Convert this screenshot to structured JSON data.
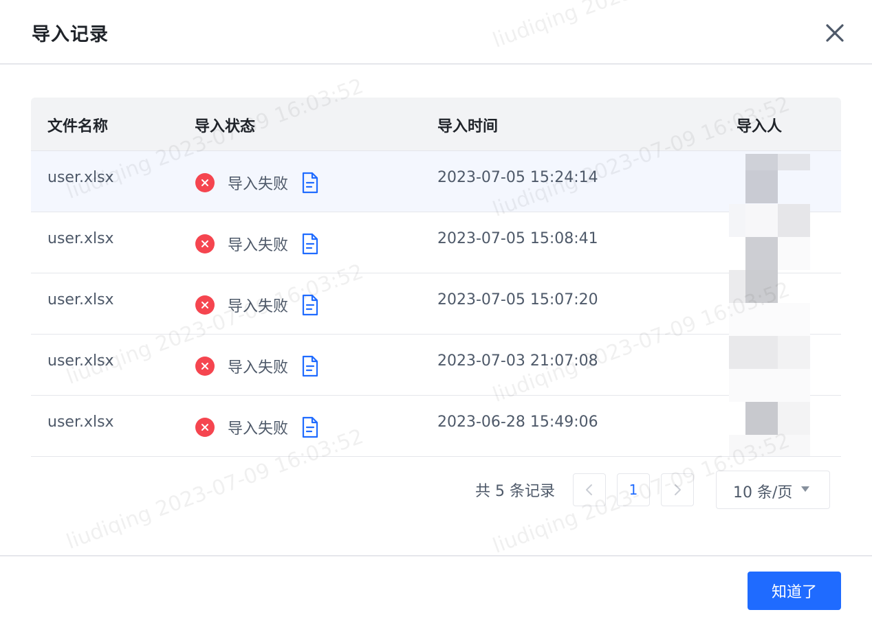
{
  "dialog": {
    "title": "导入记录",
    "close_icon": "close-icon"
  },
  "table": {
    "columns": [
      "文件名称",
      "导入状态",
      "导入时间",
      "导入人"
    ],
    "rows": [
      {
        "file": "user.xlsx",
        "status": "导入失败",
        "time": "2023-07-05 15:24:14"
      },
      {
        "file": "user.xlsx",
        "status": "导入失败",
        "time": "2023-07-05 15:08:41"
      },
      {
        "file": "user.xlsx",
        "status": "导入失败",
        "time": "2023-07-05 15:07:20"
      },
      {
        "file": "user.xlsx",
        "status": "导入失败",
        "time": "2023-07-03 21:07:08"
      },
      {
        "file": "user.xlsx",
        "status": "导入失败",
        "time": "2023-06-28 15:49:06"
      }
    ]
  },
  "pagination": {
    "total": "共 5 条记录",
    "current_page": "1",
    "page_size": "10 条/页"
  },
  "footer": {
    "ok_label": "知道了"
  },
  "watermark": "liudiqing 2023-07-09 16:03:52",
  "colors": {
    "primary": "#1f6bff",
    "error": "#f5454f",
    "header_bg": "#f2f3f5",
    "hover_row": "#f4f7fe"
  }
}
